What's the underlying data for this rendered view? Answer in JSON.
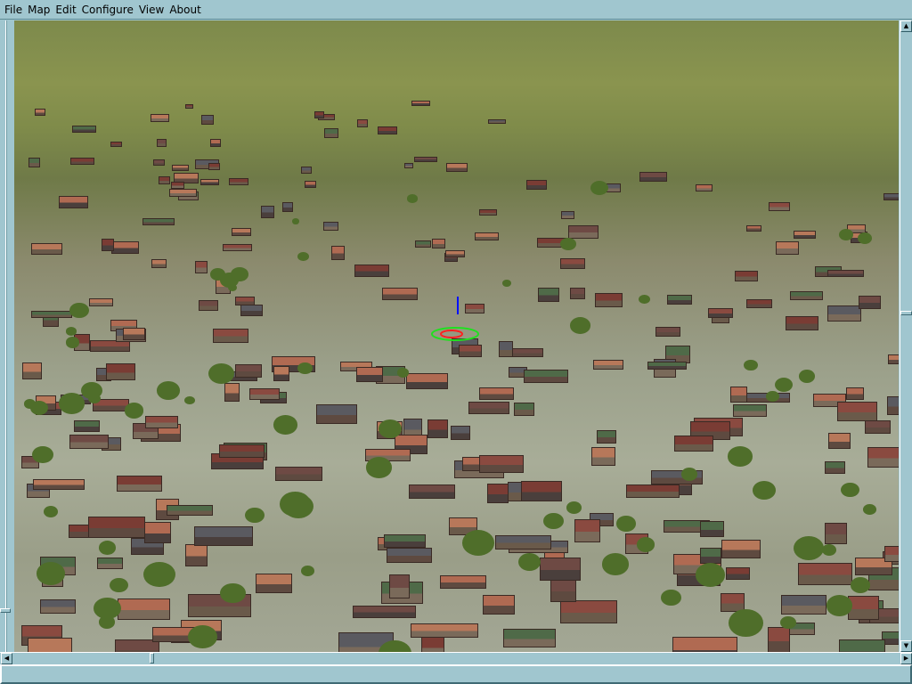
{
  "menubar": {
    "items": [
      "File",
      "Map",
      "Edit",
      "Configure",
      "View",
      "About"
    ]
  },
  "icons": {
    "scroll_up": "triangle-up",
    "scroll_left": "triangle-left",
    "scroll_right": "triangle-right"
  },
  "colors": {
    "chrome": "#a0c6cf",
    "grass": "#7d8a4c",
    "roof": "#b86a50"
  },
  "statusbar": {
    "text": ""
  }
}
